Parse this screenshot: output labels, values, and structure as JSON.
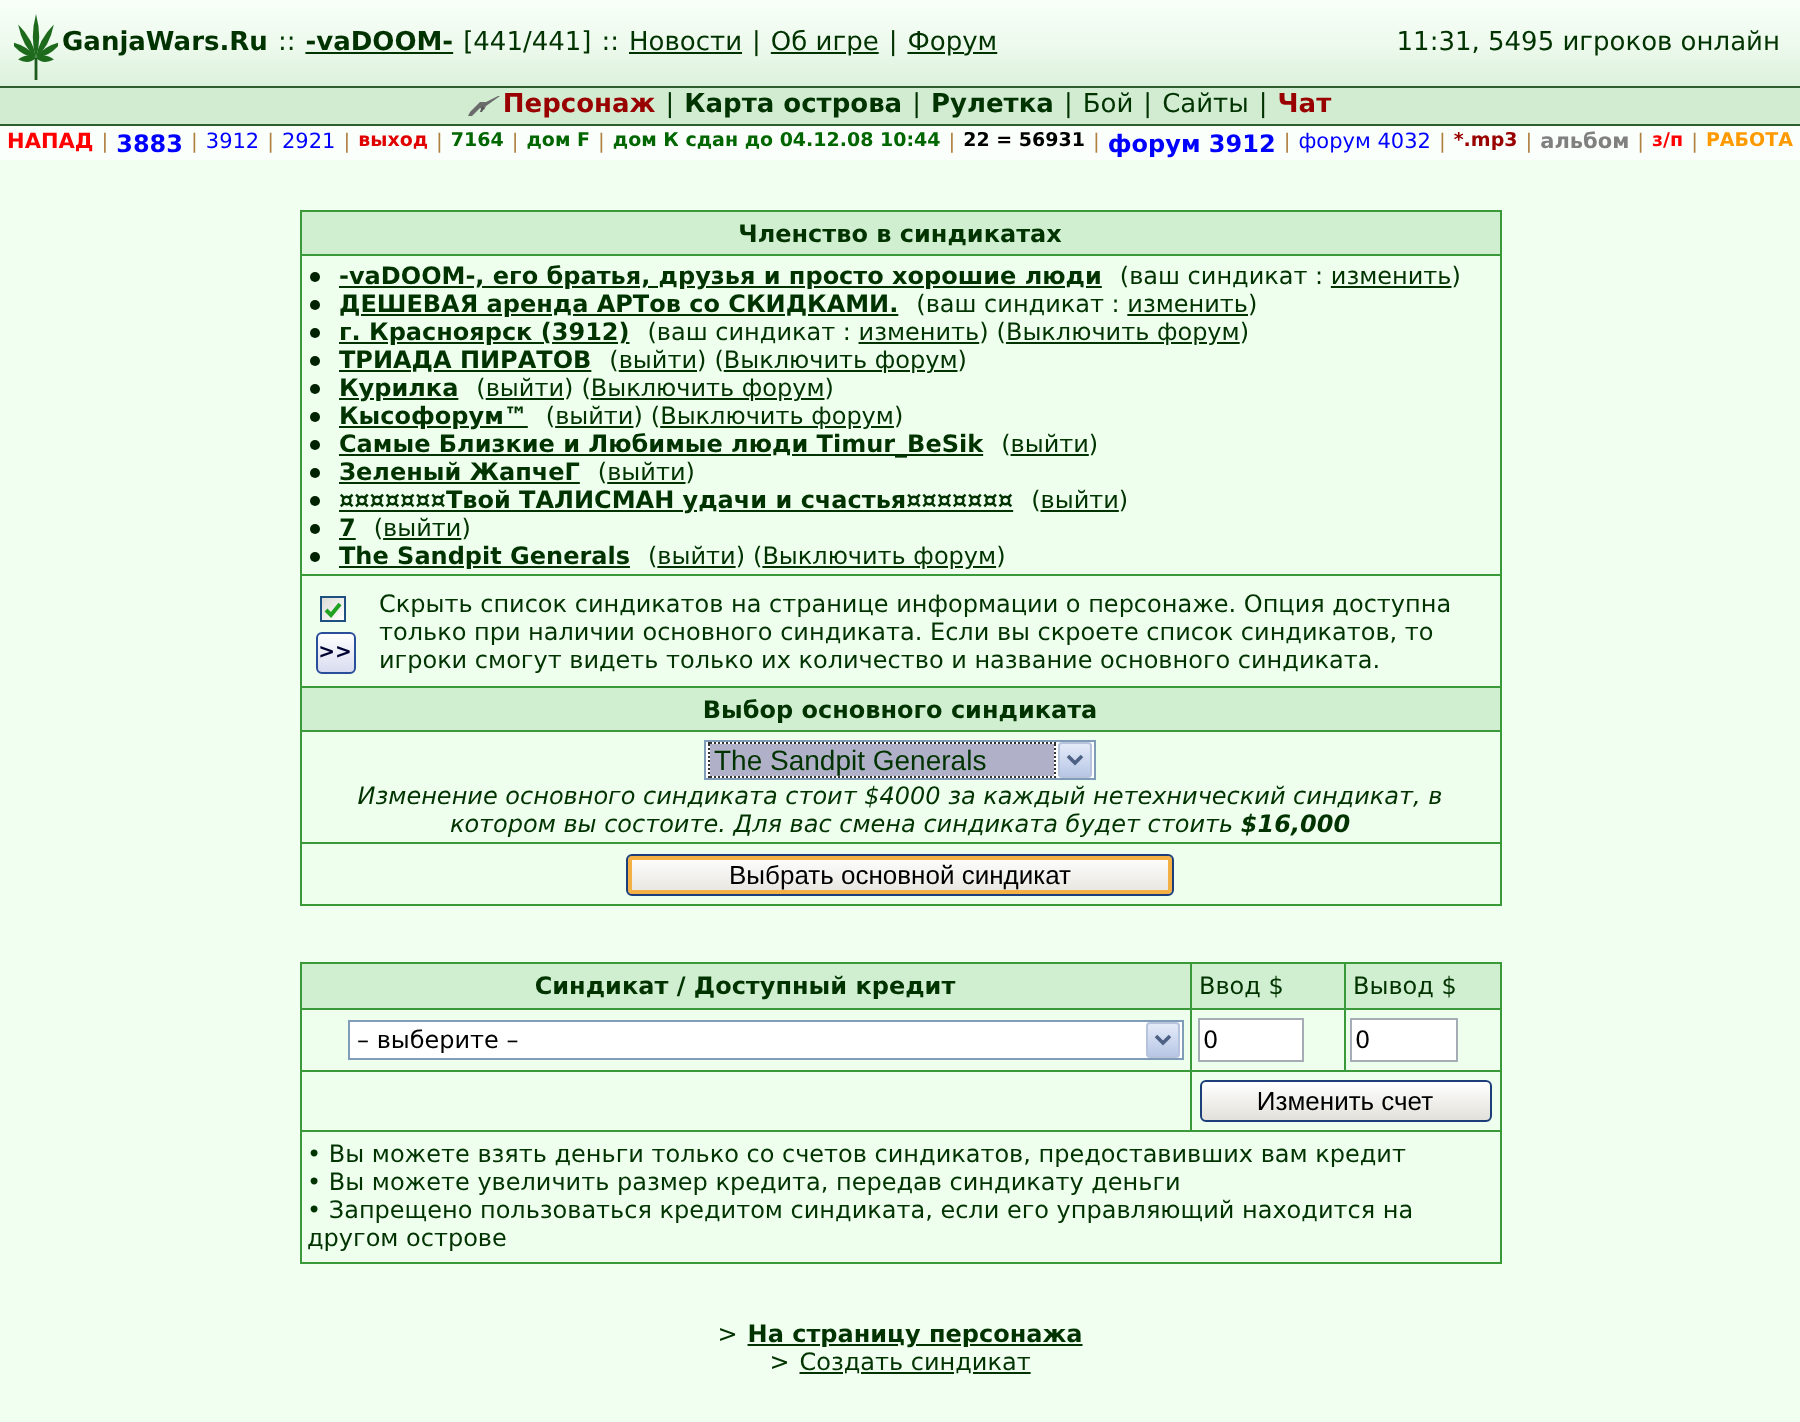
{
  "header": {
    "site": "GanjaWars.Ru",
    "items": [
      {
        "kind": "text",
        "text": "::"
      },
      {
        "kind": "user",
        "text": "-vaDOOM-"
      },
      {
        "kind": "text",
        "text": "[441/441]"
      },
      {
        "kind": "text",
        "text": "::"
      },
      {
        "kind": "link",
        "text": "Новости"
      },
      {
        "kind": "sep",
        "text": "|"
      },
      {
        "kind": "link",
        "text": "Об игре"
      },
      {
        "kind": "sep",
        "text": "|"
      },
      {
        "kind": "link",
        "text": "Форум"
      }
    ],
    "status": "11:31, 5495 игроков онлайн"
  },
  "nav": {
    "items": [
      {
        "kind": "icon-link",
        "text": "Персонаж",
        "bold": true,
        "color": "#990000"
      },
      {
        "kind": "sep",
        "text": "|"
      },
      {
        "kind": "link",
        "text": "Карта острова",
        "bold": true,
        "color": "#003300"
      },
      {
        "kind": "sep",
        "text": "|"
      },
      {
        "kind": "link",
        "text": "Рулетка",
        "bold": true,
        "color": "#003300"
      },
      {
        "kind": "sep",
        "text": "|"
      },
      {
        "kind": "link",
        "text": "Бой",
        "bold": false,
        "color": "#003300"
      },
      {
        "kind": "sep",
        "text": "|"
      },
      {
        "kind": "link",
        "text": "Сайты",
        "bold": false,
        "color": "#003300"
      },
      {
        "kind": "sep",
        "text": "|"
      },
      {
        "kind": "link",
        "text": "Чат",
        "bold": true,
        "color": "#990000"
      }
    ]
  },
  "quicklinks": {
    "items": [
      {
        "kind": "normal",
        "text": "НАПАД",
        "color": "#ff0000",
        "bold": true
      },
      {
        "kind": "sep",
        "text": "|"
      },
      {
        "kind": "large",
        "text": "3883",
        "color": "#0000ff",
        "bold": true
      },
      {
        "kind": "sep",
        "text": "|"
      },
      {
        "kind": "normal",
        "text": "3912",
        "color": "#0000ff",
        "bold": false
      },
      {
        "kind": "sep",
        "text": "|"
      },
      {
        "kind": "normal",
        "text": "2921",
        "color": "#0000ff",
        "bold": false
      },
      {
        "kind": "sep",
        "text": "|"
      },
      {
        "kind": "small",
        "text": "выход",
        "color": "#e00000",
        "bold": true
      },
      {
        "kind": "sep",
        "text": "|"
      },
      {
        "kind": "small",
        "text": "7164",
        "color": "#006600",
        "bold": true
      },
      {
        "kind": "sep",
        "text": "|"
      },
      {
        "kind": "small",
        "text": "дом F",
        "color": "#006600",
        "bold": true
      },
      {
        "kind": "sep",
        "text": "|"
      },
      {
        "kind": "small",
        "text": "дом К сдан до 04.12.08 10:44",
        "color": "#006600",
        "bold": true
      },
      {
        "kind": "sep",
        "text": "|"
      },
      {
        "kind": "small",
        "text": "22 = 56931",
        "color": "#000000",
        "bold": true
      },
      {
        "kind": "sep",
        "text": "|"
      },
      {
        "kind": "large",
        "text": "форум 3912",
        "color": "#0000ff",
        "bold": true
      },
      {
        "kind": "sep",
        "text": "|"
      },
      {
        "kind": "normal",
        "text": "форум 4032",
        "color": "#0000ff",
        "bold": false
      },
      {
        "kind": "sep",
        "text": "|"
      },
      {
        "kind": "small",
        "text": "*.mp3",
        "color": "#990000",
        "bold": true
      },
      {
        "kind": "sep",
        "text": "|"
      },
      {
        "kind": "normal",
        "text": "альбом",
        "color": "#808080",
        "bold": true
      },
      {
        "kind": "sep",
        "text": "|"
      },
      {
        "kind": "small",
        "text": "з/п",
        "color": "#ff0000",
        "bold": true
      },
      {
        "kind": "sep",
        "text": "|"
      },
      {
        "kind": "small",
        "text": "РАБОТА",
        "color": "#ff9900",
        "bold": true
      }
    ]
  },
  "membership": {
    "title": "Членство в синдикатах",
    "syndicates": [
      {
        "name": "-vaDOOM-, его братья, друзья и просто хорошие люди",
        "actions": [
          {
            "before": "(ваш синдикат : ",
            "link": "изменить",
            "after": ")"
          }
        ]
      },
      {
        "name": "ДЕШЕВАЯ аренда АРТов со СКИДКАМИ.",
        "actions": [
          {
            "before": "(ваш синдикат : ",
            "link": "изменить",
            "after": ")"
          }
        ]
      },
      {
        "name": "г. Красноярск (3912)",
        "actions": [
          {
            "before": "(ваш синдикат : ",
            "link": "изменить",
            "after": ")"
          },
          {
            "before": "(",
            "link": "Выключить форум",
            "after": ")"
          }
        ]
      },
      {
        "name": "ТРИАДА ПИРАТОВ",
        "actions": [
          {
            "before": "(",
            "link": "выйти",
            "after": ")"
          },
          {
            "before": "(",
            "link": "Выключить форум",
            "after": ")"
          }
        ]
      },
      {
        "name": "Курилка",
        "actions": [
          {
            "before": "(",
            "link": "выйти",
            "after": ")"
          },
          {
            "before": "(",
            "link": "Выключить форум",
            "after": ")"
          }
        ]
      },
      {
        "name": "Кысофорум™",
        "actions": [
          {
            "before": "(",
            "link": "выйти",
            "after": ")"
          },
          {
            "before": "(",
            "link": "Выключить форум",
            "after": ")"
          }
        ]
      },
      {
        "name": "Самые Близкие и Любимые люди Timur_BeSik",
        "actions": [
          {
            "before": "(",
            "link": "выйти",
            "after": ")"
          }
        ]
      },
      {
        "name": "Зеленый ЖапчеГ",
        "actions": [
          {
            "before": "(",
            "link": "выйти",
            "after": ")"
          }
        ]
      },
      {
        "name": "¤¤¤¤¤¤¤Твой ТАЛИСМАН удачи и счастья¤¤¤¤¤¤¤",
        "actions": [
          {
            "before": "(",
            "link": "выйти",
            "after": ")"
          }
        ]
      },
      {
        "name": "7",
        "actions": [
          {
            "before": "(",
            "link": "выйти",
            "after": ")"
          }
        ]
      },
      {
        "name": "The Sandpit Generals",
        "actions": [
          {
            "before": "(",
            "link": "выйти",
            "after": ")"
          },
          {
            "before": "(",
            "link": "Выключить форум",
            "after": ")"
          }
        ]
      }
    ],
    "option": {
      "checked": true,
      "button": ">>",
      "text": "Скрыть список синдикатов на странице информации о персонаже. Опция доступна только при наличии основного синдиката. Если вы скроете список синдикатов, то игроки смогут видеть только их количество и название основного синдиката."
    }
  },
  "primary": {
    "title": "Выбор основного синдиката",
    "select": {
      "value": "The Sandpit Generals",
      "focused": true
    },
    "note": "Изменение основного синдиката стоит $4000 за каждый нетехнический синдикат, в котором вы состоите. Для вас смена синдиката будет стоить **$16,000**",
    "button": "Выбрать основной синдикат"
  },
  "credit": {
    "columns": [
      "Синдикат / Доступный кредит",
      "Ввод $",
      "Вывод $"
    ],
    "select": {
      "value": "– выберите –",
      "focused": false
    },
    "deposit": "0",
    "withdraw": "0",
    "button": "Изменить счет",
    "notes": [
      "• Вы можете взять деньги только со счетов синдикатов, предоставивших вам кредит",
      "• Вы можете увеличить размер кредита, передав синдикату деньги",
      "• Запрещено пользоваться кредитом синдиката, если его управляющий находится на другом острове"
    ]
  },
  "footer": {
    "links": [
      {
        "prefix": ">",
        "text": "На страницу персонажа",
        "bold": true
      },
      {
        "prefix": ">",
        "text": "Создать синдикат",
        "bold": false
      }
    ]
  }
}
